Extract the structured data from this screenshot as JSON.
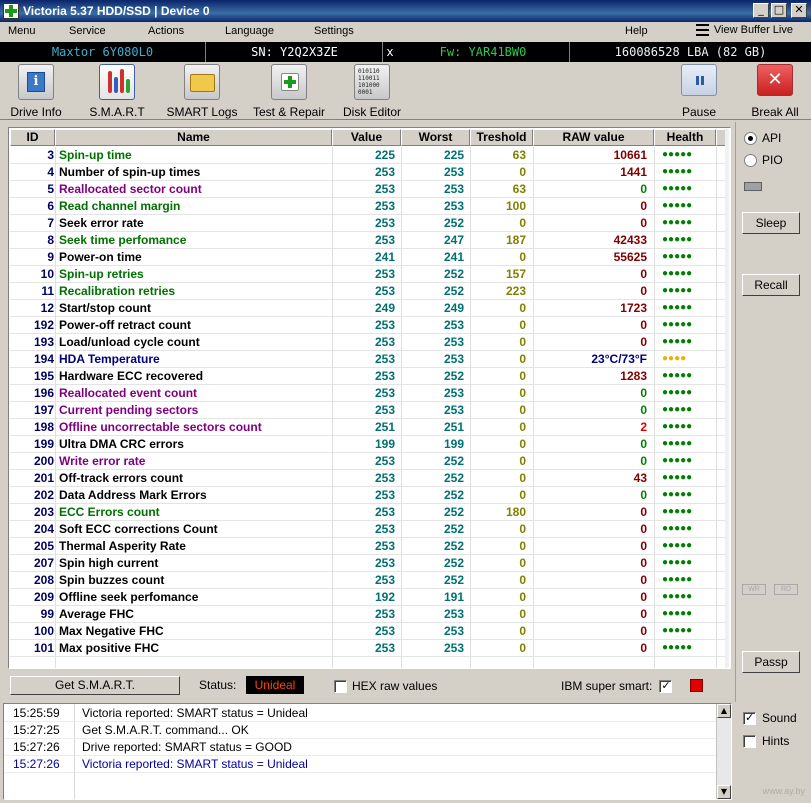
{
  "window": {
    "title": "Victoria 5.37 HDD/SSD | Device 0",
    "min": "_",
    "max": "□",
    "close": "✕"
  },
  "menu": {
    "items": [
      "Menu",
      "Service",
      "Actions",
      "Language",
      "Settings",
      "Help"
    ],
    "view_buffer": "View Buffer Live"
  },
  "info": {
    "model": "Maxtor 6Y080L0",
    "serial": "SN: Y2Q2X3ZE",
    "close_glyph": "x",
    "firmware": "Fw: YAR41BW0",
    "lba": "160086528 LBA (82 GB)"
  },
  "toolbar": {
    "drive_info": "Drive Info",
    "smart": "S.M.A.R.T",
    "smart_logs": "SMART Logs",
    "test_repair": "Test & Repair",
    "disk_editor": "Disk Editor",
    "pause": "Pause",
    "break_all": "Break All",
    "info_glyph": "i",
    "hex_lines": [
      "010110",
      "110011",
      "101000",
      "0001"
    ],
    "break_glyph": "✕"
  },
  "table": {
    "headers": {
      "id": "ID",
      "name": "Name",
      "value": "Value",
      "worst": "Worst",
      "threshold": "Treshold",
      "raw": "RAW value",
      "health": "Health"
    },
    "rows": [
      {
        "id": "3",
        "name": "Spin-up time",
        "value": "225",
        "worst": "225",
        "threshold": "63",
        "raw": "10661",
        "health": "●●●●●",
        "name_color": "#007000",
        "raw_color": "#800000",
        "health_color": "#008000"
      },
      {
        "id": "4",
        "name": "Number of spin-up times",
        "value": "253",
        "worst": "253",
        "threshold": "0",
        "raw": "1441",
        "health": "●●●●●",
        "name_color": "#000000",
        "raw_color": "#800000",
        "health_color": "#008000"
      },
      {
        "id": "5",
        "name": "Reallocated sector count",
        "value": "253",
        "worst": "253",
        "threshold": "63",
        "raw": "0",
        "health": "●●●●●",
        "name_color": "#800080",
        "raw_color": "#008000",
        "health_color": "#008000"
      },
      {
        "id": "6",
        "name": "Read channel margin",
        "value": "253",
        "worst": "253",
        "threshold": "100",
        "raw": "0",
        "health": "●●●●●",
        "name_color": "#007000",
        "raw_color": "#800000",
        "health_color": "#008000"
      },
      {
        "id": "7",
        "name": "Seek error rate",
        "value": "253",
        "worst": "252",
        "threshold": "0",
        "raw": "0",
        "health": "●●●●●",
        "name_color": "#000000",
        "raw_color": "#800000",
        "health_color": "#008000"
      },
      {
        "id": "8",
        "name": "Seek time perfomance",
        "value": "253",
        "worst": "247",
        "threshold": "187",
        "raw": "42433",
        "health": "●●●●●",
        "name_color": "#007000",
        "raw_color": "#800000",
        "health_color": "#008000"
      },
      {
        "id": "9",
        "name": "Power-on time",
        "value": "241",
        "worst": "241",
        "threshold": "0",
        "raw": "55625",
        "health": "●●●●●",
        "name_color": "#000000",
        "raw_color": "#800000",
        "health_color": "#008000"
      },
      {
        "id": "10",
        "name": "Spin-up retries",
        "value": "253",
        "worst": "252",
        "threshold": "157",
        "raw": "0",
        "health": "●●●●●",
        "name_color": "#007000",
        "raw_color": "#800000",
        "health_color": "#008000"
      },
      {
        "id": "11",
        "name": "Recalibration retries",
        "value": "253",
        "worst": "252",
        "threshold": "223",
        "raw": "0",
        "health": "●●●●●",
        "name_color": "#007000",
        "raw_color": "#800000",
        "health_color": "#008000"
      },
      {
        "id": "12",
        "name": "Start/stop count",
        "value": "249",
        "worst": "249",
        "threshold": "0",
        "raw": "1723",
        "health": "●●●●●",
        "name_color": "#000000",
        "raw_color": "#800000",
        "health_color": "#008000"
      },
      {
        "id": "192",
        "name": "Power-off retract count",
        "value": "253",
        "worst": "253",
        "threshold": "0",
        "raw": "0",
        "health": "●●●●●",
        "name_color": "#000000",
        "raw_color": "#800000",
        "health_color": "#008000"
      },
      {
        "id": "193",
        "name": "Load/unload cycle count",
        "value": "253",
        "worst": "253",
        "threshold": "0",
        "raw": "0",
        "health": "●●●●●",
        "name_color": "#000000",
        "raw_color": "#800000",
        "health_color": "#008000"
      },
      {
        "id": "194",
        "name": "HDA Temperature",
        "value": "253",
        "worst": "253",
        "threshold": "0",
        "raw": "23°C/73°F",
        "health": "●●●●",
        "name_color": "#000080",
        "raw_color": "#000080",
        "health_color": "#f0b000"
      },
      {
        "id": "195",
        "name": "Hardware ECC recovered",
        "value": "253",
        "worst": "252",
        "threshold": "0",
        "raw": "1283",
        "health": "●●●●●",
        "name_color": "#000000",
        "raw_color": "#800000",
        "health_color": "#008000"
      },
      {
        "id": "196",
        "name": "Reallocated event count",
        "value": "253",
        "worst": "253",
        "threshold": "0",
        "raw": "0",
        "health": "●●●●●",
        "name_color": "#800080",
        "raw_color": "#008000",
        "health_color": "#008000"
      },
      {
        "id": "197",
        "name": "Current pending sectors",
        "value": "253",
        "worst": "253",
        "threshold": "0",
        "raw": "0",
        "health": "●●●●●",
        "name_color": "#800080",
        "raw_color": "#008000",
        "health_color": "#008000"
      },
      {
        "id": "198",
        "name": "Offline uncorrectable sectors count",
        "value": "251",
        "worst": "251",
        "threshold": "0",
        "raw": "2",
        "health": "●●●●●",
        "name_color": "#800080",
        "raw_color": "#e00000",
        "health_color": "#008000"
      },
      {
        "id": "199",
        "name": "Ultra DMA CRC errors",
        "value": "199",
        "worst": "199",
        "threshold": "0",
        "raw": "0",
        "health": "●●●●●",
        "name_color": "#000000",
        "raw_color": "#008000",
        "health_color": "#008000"
      },
      {
        "id": "200",
        "name": "Write error rate",
        "value": "253",
        "worst": "252",
        "threshold": "0",
        "raw": "0",
        "health": "●●●●●",
        "name_color": "#800080",
        "raw_color": "#008000",
        "health_color": "#008000"
      },
      {
        "id": "201",
        "name": "Off-track errors count",
        "value": "253",
        "worst": "252",
        "threshold": "0",
        "raw": "43",
        "health": "●●●●●",
        "name_color": "#000000",
        "raw_color": "#800000",
        "health_color": "#008000"
      },
      {
        "id": "202",
        "name": "Data Address Mark Errors",
        "value": "253",
        "worst": "252",
        "threshold": "0",
        "raw": "0",
        "health": "●●●●●",
        "name_color": "#000000",
        "raw_color": "#008000",
        "health_color": "#008000"
      },
      {
        "id": "203",
        "name": "ECC Errors count",
        "value": "253",
        "worst": "252",
        "threshold": "180",
        "raw": "0",
        "health": "●●●●●",
        "name_color": "#007000",
        "raw_color": "#800000",
        "health_color": "#008000"
      },
      {
        "id": "204",
        "name": "Soft ECC corrections Count",
        "value": "253",
        "worst": "252",
        "threshold": "0",
        "raw": "0",
        "health": "●●●●●",
        "name_color": "#000000",
        "raw_color": "#800000",
        "health_color": "#008000"
      },
      {
        "id": "205",
        "name": "Thermal Asperity Rate",
        "value": "253",
        "worst": "252",
        "threshold": "0",
        "raw": "0",
        "health": "●●●●●",
        "name_color": "#000000",
        "raw_color": "#800000",
        "health_color": "#008000"
      },
      {
        "id": "207",
        "name": "Spin high current",
        "value": "253",
        "worst": "252",
        "threshold": "0",
        "raw": "0",
        "health": "●●●●●",
        "name_color": "#000000",
        "raw_color": "#800000",
        "health_color": "#008000"
      },
      {
        "id": "208",
        "name": "Spin buzzes count",
        "value": "253",
        "worst": "252",
        "threshold": "0",
        "raw": "0",
        "health": "●●●●●",
        "name_color": "#000000",
        "raw_color": "#800000",
        "health_color": "#008000"
      },
      {
        "id": "209",
        "name": "Offline seek perfomance",
        "value": "192",
        "worst": "191",
        "threshold": "0",
        "raw": "0",
        "health": "●●●●●",
        "name_color": "#000000",
        "raw_color": "#800000",
        "health_color": "#008000"
      },
      {
        "id": "99",
        "name": "Average FHC",
        "value": "253",
        "worst": "253",
        "threshold": "0",
        "raw": "0",
        "health": "●●●●●",
        "name_color": "#000000",
        "raw_color": "#800000",
        "health_color": "#008000"
      },
      {
        "id": "100",
        "name": "Max Negative FHC",
        "value": "253",
        "worst": "253",
        "threshold": "0",
        "raw": "0",
        "health": "●●●●●",
        "name_color": "#000000",
        "raw_color": "#800000",
        "health_color": "#008000"
      },
      {
        "id": "101",
        "name": "Max positive FHC",
        "value": "253",
        "worst": "253",
        "threshold": "0",
        "raw": "0",
        "health": "●●●●●",
        "name_color": "#000000",
        "raw_color": "#800000",
        "health_color": "#008000"
      }
    ]
  },
  "status": {
    "get_smart": "Get S.M.A.R.T.",
    "label": "Status:",
    "value": "Unideal",
    "hex_raw": "HEX raw values",
    "ibm_super": "IBM super smart:"
  },
  "side": {
    "api": "API",
    "pio": "PIO",
    "sleep": "Sleep",
    "recall": "Recall",
    "passp": "Passp",
    "wr": "WR",
    "rd": "RD"
  },
  "log": {
    "lines": [
      {
        "time": "15:25:59",
        "msg": "Victoria reported: SMART status = Unideal",
        "color": "#000000"
      },
      {
        "time": "15:27:25",
        "msg": "Get S.M.A.R.T. command... OK",
        "color": "#000000"
      },
      {
        "time": "15:27:26",
        "msg": "Drive reported: SMART status = GOOD",
        "color": "#000000"
      },
      {
        "time": "15:27:26",
        "msg": "Victoria reported: SMART status = Unideal",
        "color": "#0000a0"
      }
    ],
    "up": "▲",
    "down": "▼"
  },
  "options": {
    "sound": "Sound",
    "hints": "Hints"
  },
  "watermark": "www.ay.by"
}
